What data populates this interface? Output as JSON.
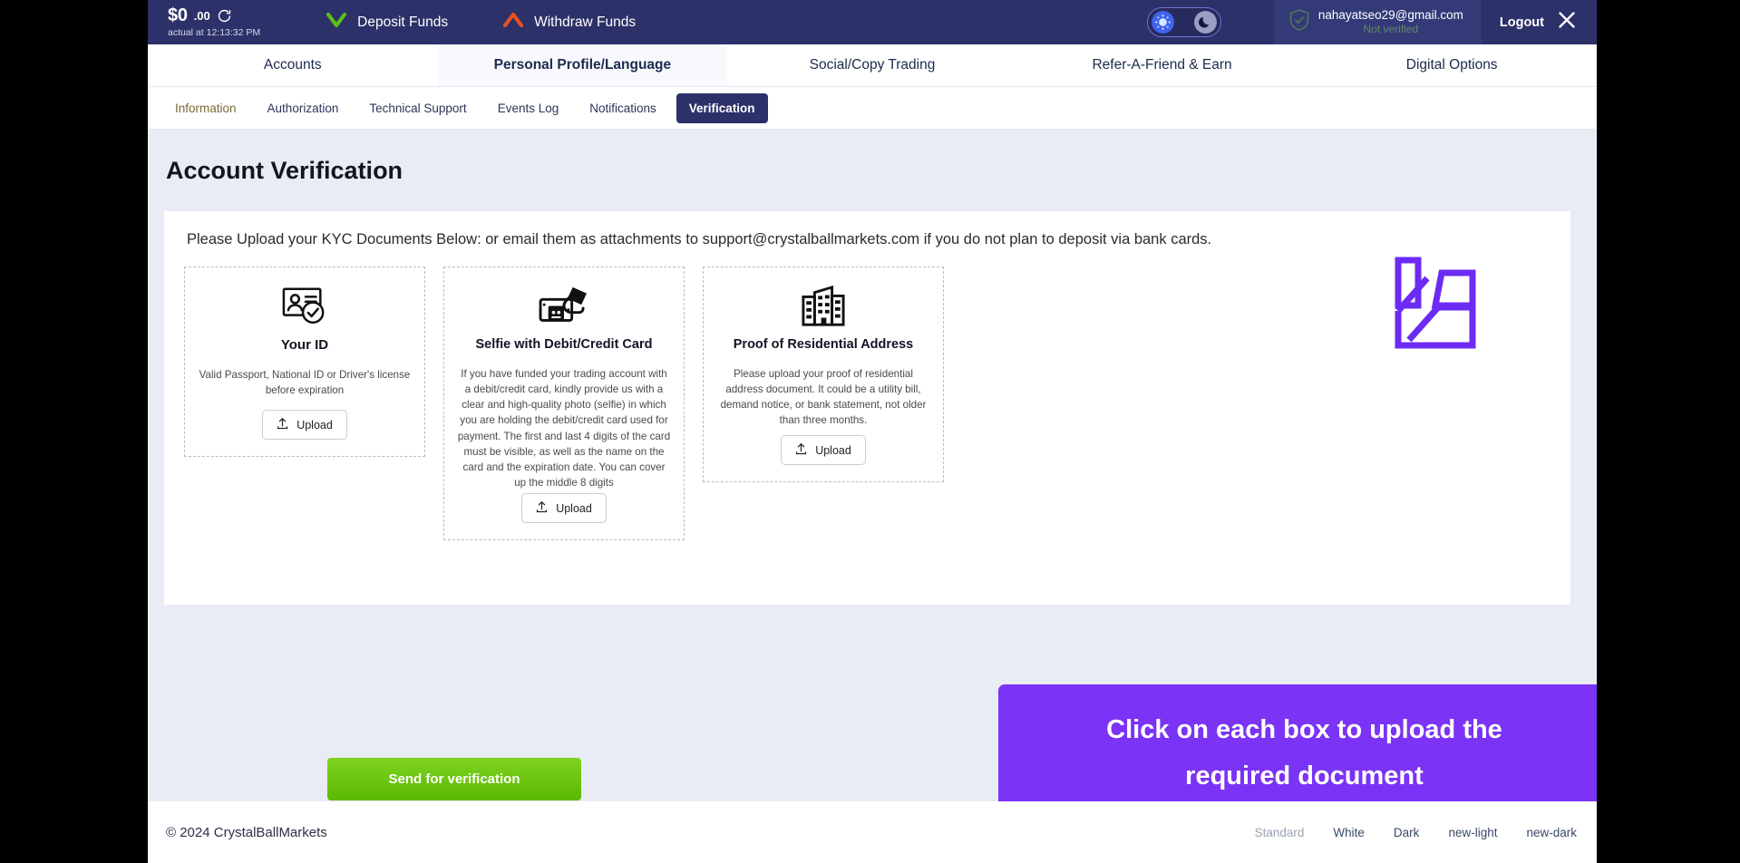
{
  "topbar": {
    "balance_main": "$0",
    "balance_cents": ".00",
    "balance_sub": "actual at 12:13:32 PM",
    "refresh_icon": "refresh-icon",
    "deposit_label": "Deposit Funds",
    "deposit_icon": "chevron-down-green-icon",
    "withdraw_label": "Withdraw Funds",
    "withdraw_icon": "chevron-up-orange-icon",
    "theme_toggle": {
      "sun_icon": "sun-icon",
      "moon_icon": "moon-icon",
      "active": "sun"
    },
    "account": {
      "shield_icon": "shield-check-icon",
      "email": "nahayatseo29@gmail.com",
      "status": "Not verified",
      "status_color": "#5c8b63"
    },
    "logout_label": "Logout",
    "logout_icon": "close-x-icon"
  },
  "mainnav": {
    "items": [
      {
        "label": "Accounts",
        "active": false
      },
      {
        "label": "Personal Profile/Language",
        "active": true
      },
      {
        "label": "Social/Copy Trading",
        "active": false
      },
      {
        "label": "Refer-A-Friend & Earn",
        "active": false
      },
      {
        "label": "Digital Options",
        "active": false
      }
    ]
  },
  "subnav": {
    "items": [
      {
        "label": "Information",
        "active": false
      },
      {
        "label": "Authorization",
        "active": false
      },
      {
        "label": "Technical Support",
        "active": false
      },
      {
        "label": "Events Log",
        "active": false
      },
      {
        "label": "Notifications",
        "active": false
      },
      {
        "label": "Verification",
        "active": true
      }
    ]
  },
  "page": {
    "title": "Account Verification",
    "intro": "Please Upload your KYC Documents Below: or email them as attachments to support@crystalballmarkets.com if you do not plan to deposit via bank cards.",
    "cards": [
      {
        "icon": "id-card-check-icon",
        "title": "Your ID",
        "description": "Valid Passport, National ID or Driver's license before expiration",
        "upload_label": "Upload",
        "upload_icon": "upload-icon"
      },
      {
        "icon": "selfie-phone-hand-icon",
        "title": "Selfie with Debit/Credit Card",
        "description": "If you have funded your trading account with a debit/credit card, kindly provide us with a clear and high-quality photo (selfie) in which you are holding the debit/credit card used for payment. The first and last 4 digits of the card must be visible, as well as the name on the card and the expiration date. You can cover up the middle 8 digits",
        "upload_label": "Upload",
        "upload_icon": "upload-icon"
      },
      {
        "icon": "buildings-icon",
        "title": "Proof of Residential Address",
        "description": "Please upload your proof of residential address document. It could be a utility bill, demand notice, or bank statement, not older than three months.",
        "upload_label": "Upload",
        "upload_icon": "upload-icon"
      }
    ],
    "send_button": "Send for verification",
    "send_button_color": "#6cc51d",
    "callout_line1": "Click on each box to upload the",
    "callout_line2": "required document",
    "callout_color": "#7b33f5",
    "logo_icon": "crystalball-logo-icon",
    "logo_color": "#7b33f5"
  },
  "footer": {
    "copyright": "© 2024 CrystalBallMarkets",
    "themes": [
      {
        "label": "Standard",
        "muted": true
      },
      {
        "label": "White",
        "muted": false
      },
      {
        "label": "Dark",
        "muted": false
      },
      {
        "label": "new-light",
        "muted": false
      },
      {
        "label": "new-dark",
        "muted": false
      }
    ]
  }
}
